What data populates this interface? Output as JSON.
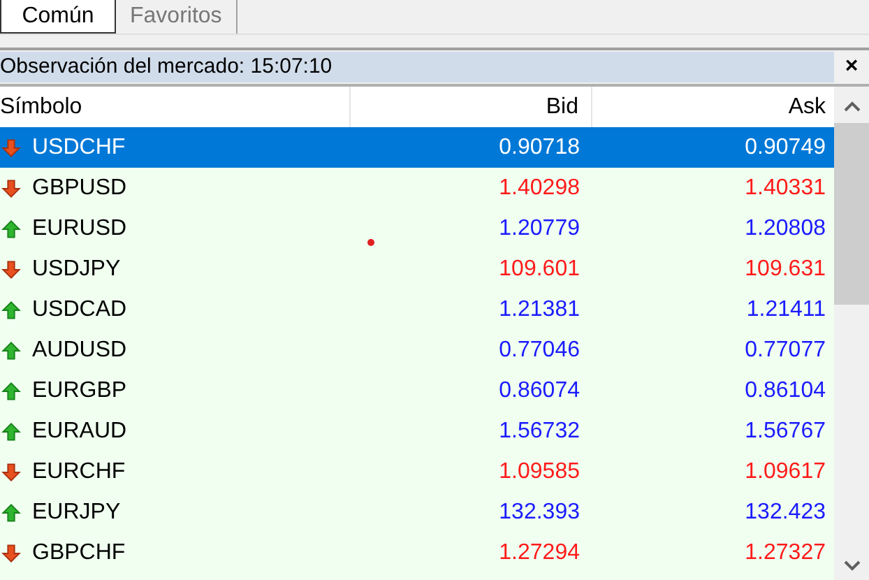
{
  "tabs": [
    {
      "label": "Común",
      "selected": true
    },
    {
      "label": "Favoritos",
      "selected": false
    }
  ],
  "panel": {
    "title": "Observación del mercado: 15:07:10",
    "close": "×"
  },
  "table": {
    "columns": [
      "Símbolo",
      "Bid",
      "Ask"
    ],
    "rows": [
      {
        "symbol": "USDCHF",
        "bid": "0.90718",
        "ask": "0.90749",
        "kind": "down",
        "selected": true
      },
      {
        "symbol": "GBPUSD",
        "bid": "1.40298",
        "ask": "1.40331",
        "kind": "down",
        "selected": false
      },
      {
        "symbol": "EURUSD",
        "bid": "1.20779",
        "ask": "1.20808",
        "kind": "up",
        "selected": false
      },
      {
        "symbol": "USDJPY",
        "bid": "109.601",
        "ask": "109.631",
        "kind": "down",
        "selected": false
      },
      {
        "symbol": "USDCAD",
        "bid": "1.21381",
        "ask": "1.21411",
        "kind": "up",
        "selected": false
      },
      {
        "symbol": "AUDUSD",
        "bid": "0.77046",
        "ask": "0.77077",
        "kind": "up",
        "selected": false
      },
      {
        "symbol": "EURGBP",
        "bid": "0.86074",
        "ask": "0.86104",
        "kind": "up",
        "selected": false
      },
      {
        "symbol": "EURAUD",
        "bid": "1.56732",
        "ask": "1.56767",
        "kind": "up",
        "selected": false
      },
      {
        "symbol": "EURCHF",
        "bid": "1.09585",
        "ask": "1.09617",
        "kind": "down",
        "selected": false
      },
      {
        "symbol": "EURJPY",
        "bid": "132.393",
        "ask": "132.423",
        "kind": "up",
        "selected": false
      },
      {
        "symbol": "GBPCHF",
        "bid": "1.27294",
        "ask": "1.27327",
        "kind": "down",
        "selected": false
      }
    ]
  }
}
